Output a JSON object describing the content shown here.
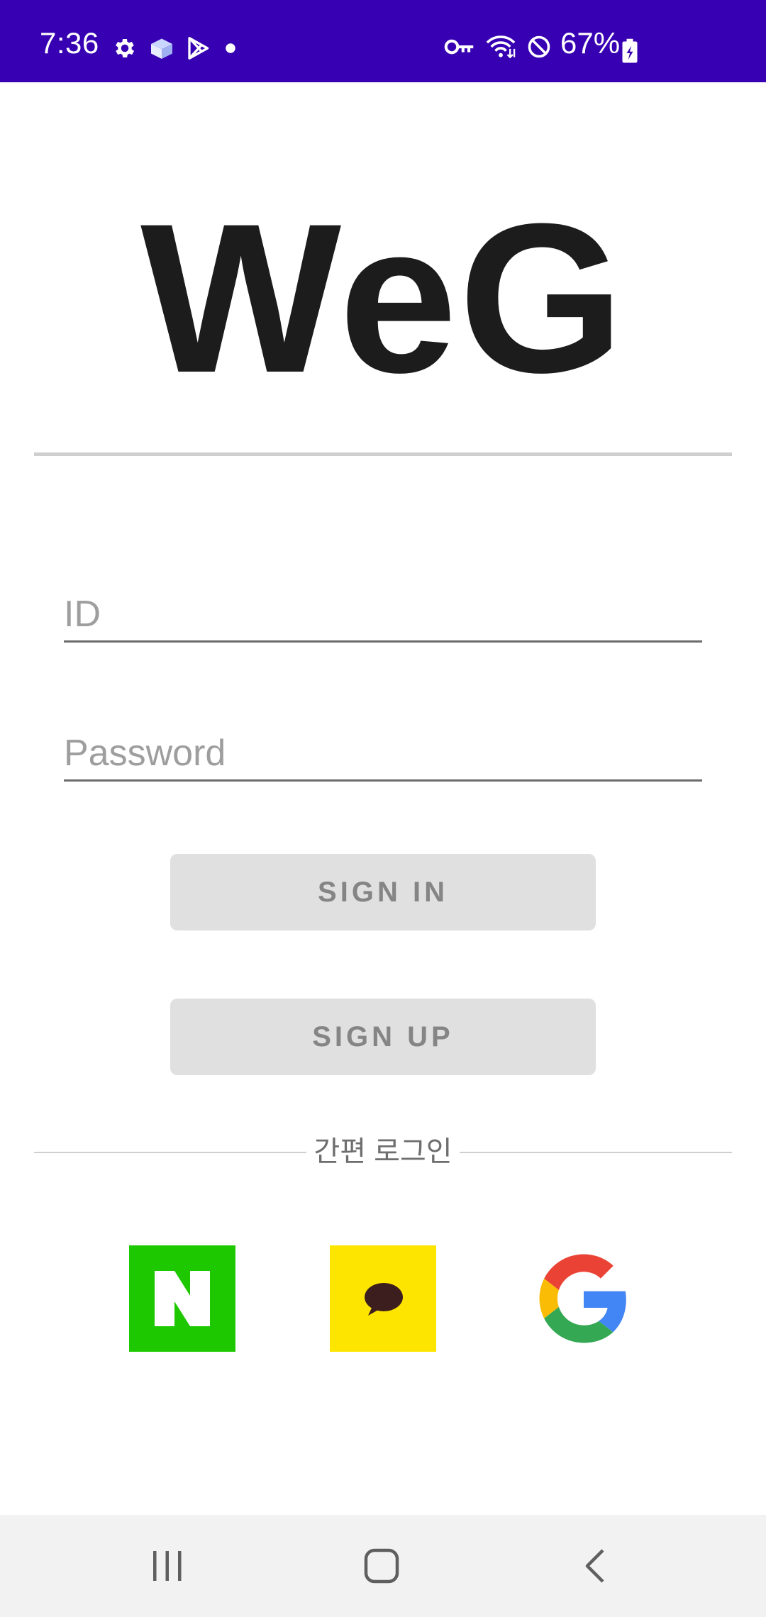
{
  "status_bar": {
    "time": "7:36",
    "battery_percent": "67%",
    "left_icons": [
      "gear-icon",
      "box-icon",
      "play-store-icon",
      "dot-icon"
    ],
    "right_icons": [
      "vpn-key-icon",
      "wifi-icon",
      "do-not-disturb-icon",
      "battery-charging-icon"
    ],
    "background_color": "#3700b3"
  },
  "logo": {
    "text": "WeG"
  },
  "login_form": {
    "id_placeholder": "ID",
    "id_value": "",
    "password_placeholder": "Password",
    "password_value": "",
    "signin_label": "SIGN IN",
    "signup_label": "SIGN UP"
  },
  "easy_login": {
    "label": "간편 로그인",
    "providers": [
      {
        "name": "naver",
        "icon": "naver-icon",
        "color": "#1ec800"
      },
      {
        "name": "kakao",
        "icon": "kakao-icon",
        "color": "#fee500"
      },
      {
        "name": "google",
        "icon": "google-icon"
      }
    ]
  },
  "nav_bar": {
    "buttons": [
      "recents-icon",
      "home-icon",
      "back-icon"
    ]
  }
}
